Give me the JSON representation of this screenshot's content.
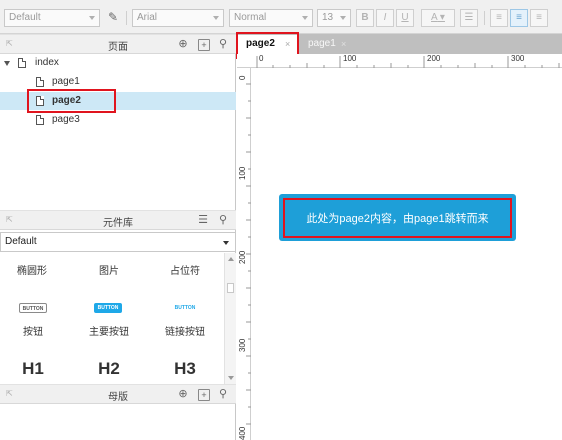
{
  "toolbar": {
    "style_select": "Default",
    "font_select": "Arial",
    "weight_select": "Normal",
    "size_select": "13",
    "bold": "B",
    "italic": "I",
    "underline": "U",
    "font_color": "A"
  },
  "pages_panel": {
    "title": "页面",
    "tree": [
      {
        "label": "index",
        "selected": false
      },
      {
        "label": "page1",
        "selected": false
      },
      {
        "label": "page2",
        "selected": true
      },
      {
        "label": "page3",
        "selected": false
      }
    ]
  },
  "library_panel": {
    "title": "元件库",
    "selected_library": "Default",
    "items": [
      {
        "label": "椭圆形"
      },
      {
        "label": "图片"
      },
      {
        "label": "占位符"
      },
      {
        "label": "按钮",
        "preview": "BUTTON"
      },
      {
        "label": "主要按钮",
        "preview": "BUTTON"
      },
      {
        "label": "链接按钮",
        "preview": "BUTTON"
      },
      {
        "label": "H1"
      },
      {
        "label": "H2"
      },
      {
        "label": "H3"
      }
    ]
  },
  "masters_panel": {
    "title": "母版"
  },
  "tabs": [
    {
      "label": "page2",
      "close": "×",
      "active": true
    },
    {
      "label": "page1",
      "close": "×",
      "active": false
    }
  ],
  "ruler": {
    "top_marks": [
      "0",
      "100",
      "200",
      "300"
    ],
    "left_marks": [
      "0",
      "100",
      "200",
      "300",
      "400"
    ]
  },
  "canvas": {
    "widget_text": "此处为page2内容，由page1跳转而来",
    "widget_color": "#1e9fd8"
  },
  "colors": {
    "highlight_red": "#e0141e",
    "selection_blue": "#cde8f6",
    "accent": "#1ea8e8"
  }
}
